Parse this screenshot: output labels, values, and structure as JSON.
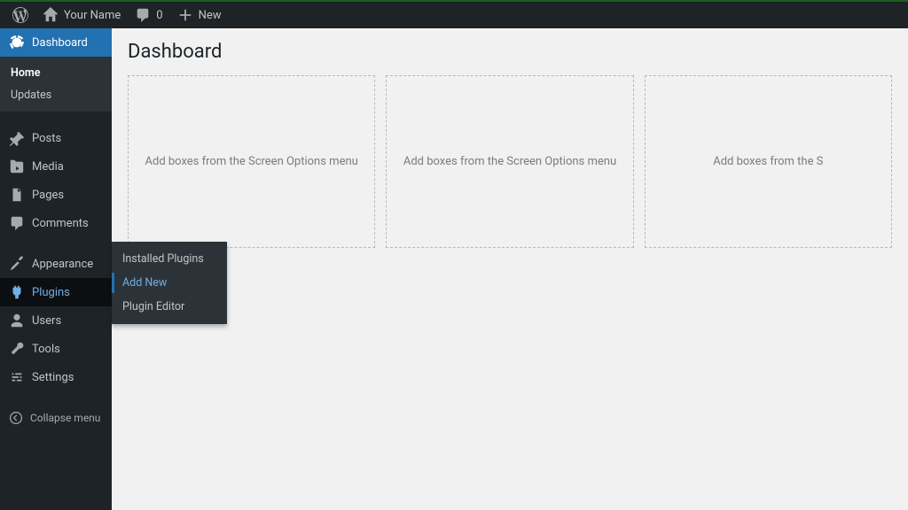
{
  "adminbar": {
    "site_name": "Your Name",
    "comments_count": "0",
    "new_label": "New"
  },
  "sidebar": {
    "dashboard": "Dashboard",
    "dashboard_sub": {
      "home": "Home",
      "updates": "Updates"
    },
    "posts": "Posts",
    "media": "Media",
    "pages": "Pages",
    "comments": "Comments",
    "appearance": "Appearance",
    "plugins": "Plugins",
    "users": "Users",
    "tools": "Tools",
    "settings": "Settings",
    "collapse": "Collapse menu"
  },
  "flyout": {
    "installed": "Installed Plugins",
    "add_new": "Add New",
    "editor": "Plugin Editor"
  },
  "page": {
    "title": "Dashboard",
    "box_hint": "Add boxes from the Screen Options menu",
    "box_hint_cut": "Add boxes from the S"
  }
}
